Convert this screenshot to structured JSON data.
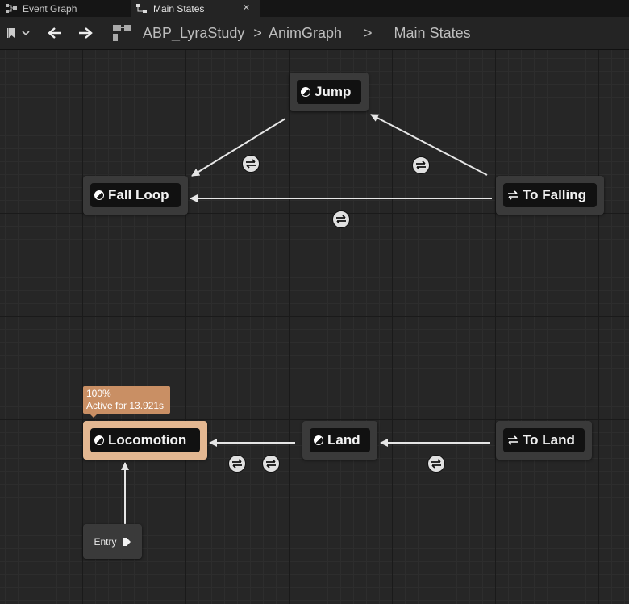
{
  "tabs": [
    {
      "label": "Event Graph",
      "icon": "event-graph-icon"
    },
    {
      "label": "Main States",
      "icon": "state-machine-icon",
      "close": "✕"
    }
  ],
  "breadcrumb": {
    "items": [
      "ABP_LyraStudy",
      "AnimGraph",
      "Main States"
    ],
    "separator": ">"
  },
  "states": [
    {
      "id": "jump",
      "label": "Jump",
      "kind": "state"
    },
    {
      "id": "fall-loop",
      "label": "Fall Loop",
      "kind": "state"
    },
    {
      "id": "to-falling",
      "label": "To Falling",
      "kind": "conduit"
    },
    {
      "id": "locomotion",
      "label": "Locomotion",
      "kind": "state",
      "active": true
    },
    {
      "id": "land",
      "label": "Land",
      "kind": "state"
    },
    {
      "id": "to-land",
      "label": "To Land",
      "kind": "conduit"
    }
  ],
  "active_state": {
    "weight": "100%",
    "status": "Active for 13.921s"
  },
  "entry": {
    "label": "Entry"
  },
  "colors": {
    "background": "#262626",
    "node": "#3a3a3a",
    "active_node": "#e3b791",
    "tooltip": "#c98f64",
    "wire": "#e6e6e6"
  }
}
